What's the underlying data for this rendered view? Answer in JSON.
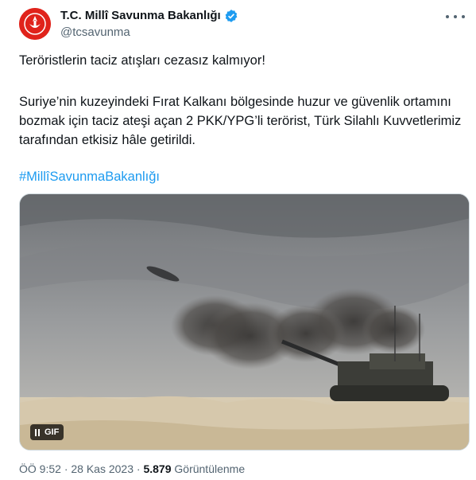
{
  "account": {
    "display_name": "T.C. Millî Savunma Bakanlığı",
    "handle": "@tcsavunma"
  },
  "tweet": {
    "line1": "Teröristlerin taciz atışları cezasız kalmıyor!",
    "paragraph": "Suriye’nin kuzeyindeki Fırat Kalkanı bölgesinde huzur ve güvenlik ortamını bozmak için taciz ateşi açan 2 PKK/YPG’li terörist, Türk Silahlı Kuvvetlerimiz tarafından etkisiz hâle getirildi.",
    "hashtag": "#MillîSavunmaBakanlığı"
  },
  "media": {
    "badge": "GIF"
  },
  "meta": {
    "time": "ÖÖ 9:52",
    "sep1": "·",
    "date": "28 Kas 2023",
    "sep2": "·",
    "views_count": "5.879",
    "views_label": "Görüntülenme"
  },
  "colors": {
    "link": "#1d9bf0",
    "verified": "#1d9bf0",
    "avatar_red": "#e0231b"
  },
  "icons": [
    "ministry-logo-icon",
    "verified-badge-icon",
    "more-options-icon",
    "pause-icon"
  ]
}
